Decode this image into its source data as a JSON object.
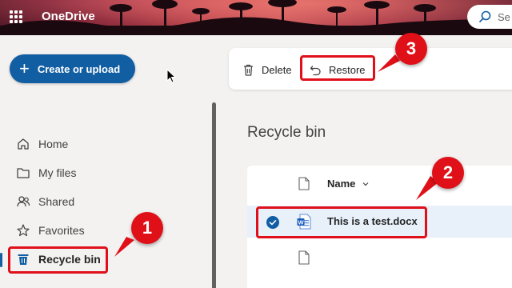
{
  "app": {
    "brand": "OneDrive"
  },
  "search": {
    "label": "Se",
    "icon": "search-icon"
  },
  "create": {
    "label": "Create or upload",
    "icon": "plus-icon"
  },
  "nav": [
    {
      "label": "Home",
      "icon": "home-icon"
    },
    {
      "label": "My files",
      "icon": "folder-icon"
    },
    {
      "label": "Shared",
      "icon": "people-icon"
    },
    {
      "label": "Favorites",
      "icon": "star-icon"
    },
    {
      "label": "Recycle bin",
      "icon": "recycle-bin-icon",
      "active": true
    }
  ],
  "commands": {
    "delete": "Delete",
    "restore": "Restore"
  },
  "main": {
    "title": "Recycle bin",
    "column_name": "Name",
    "files": [
      {
        "name": "This is a test.docx",
        "selected": true,
        "icon": "word-doc-icon"
      },
      {
        "name": "",
        "selected": false,
        "icon": "file-icon"
      }
    ]
  },
  "annotations": {
    "step1": "1",
    "step2": "2",
    "step3": "3"
  },
  "colors": {
    "accent": "#115ea3",
    "annotation": "#e01018"
  }
}
